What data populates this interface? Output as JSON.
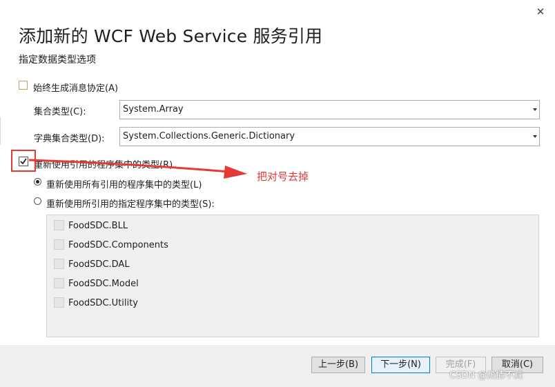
{
  "dialog": {
    "close_glyph": "✕",
    "title": "添加新的 WCF Web Service 服务引用",
    "subtitle": "指定数据类型选项"
  },
  "options": {
    "always_generate_label": "始终生成消息协定(A)",
    "always_generate_checked": false,
    "collection_type_label": "集合类型(C):",
    "collection_type_value": "System.Array",
    "dictionary_type_label": "字典集合类型(D):",
    "dictionary_type_value": "System.Collections.Generic.Dictionary",
    "reuse_types_label": "重新使用引用的程序集中的类型(R)",
    "reuse_types_checked": true,
    "radio_all_label": "重新使用所有引用的程序集中的类型(L)",
    "radio_specified_label": "重新使用所引用的指定程序集中的类型(S):",
    "selected_radio": "all"
  },
  "assemblies": [
    {
      "label": "FoodSDC.BLL",
      "checked": false
    },
    {
      "label": "FoodSDC.Components",
      "checked": false
    },
    {
      "label": "FoodSDC.DAL",
      "checked": false
    },
    {
      "label": "FoodSDC.Model",
      "checked": false
    },
    {
      "label": "FoodSDC.Utility",
      "checked": false
    }
  ],
  "footer": {
    "prev_label": "上一步(B)",
    "next_label": "下一步(N)",
    "finish_label": "完成(F)",
    "cancel_label": "取消(C)"
  },
  "annotation": {
    "text": "把对号去掉",
    "color": "#e53935"
  },
  "watermark": "CSDN @热情不减"
}
